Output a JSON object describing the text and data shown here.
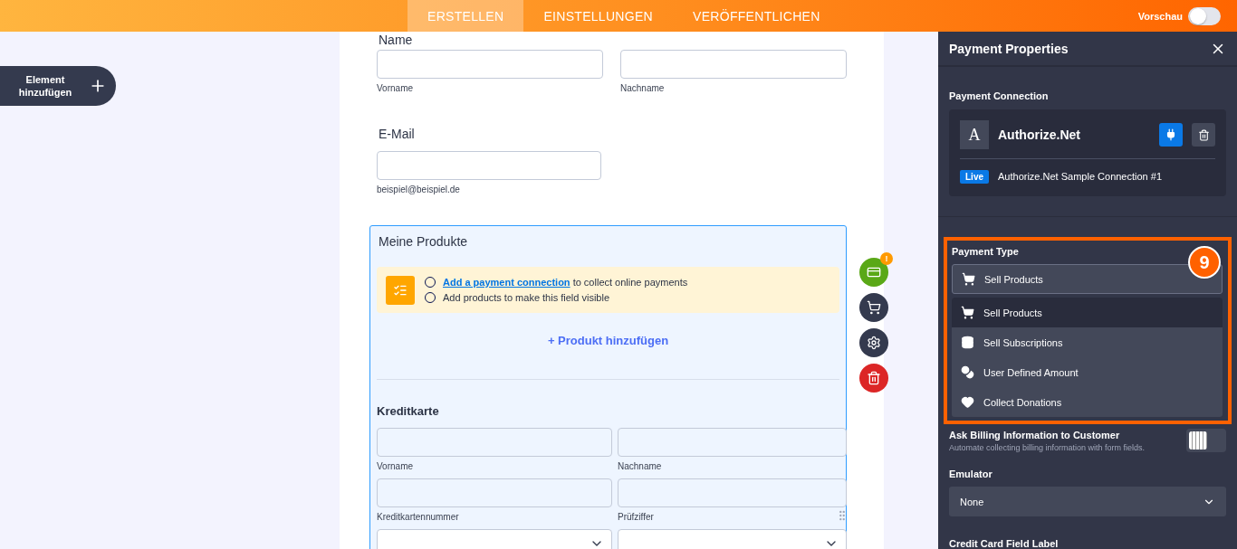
{
  "top_bar": {
    "tabs": [
      {
        "label": "ERSTELLEN",
        "selected": true
      },
      {
        "label": "EINSTELLUNGEN",
        "selected": false
      },
      {
        "label": "VERÖFFENTLICHEN",
        "selected": false
      }
    ],
    "preview": {
      "label": "Vorschau",
      "on": false
    }
  },
  "add_element_button": {
    "label": "Element hinzufügen"
  },
  "form": {
    "name_field": {
      "label": "Name",
      "sublabels": [
        "Vorname",
        "Nachname"
      ]
    },
    "email_field": {
      "label": "E-Mail",
      "sublabel": "beispiel@beispiel.de"
    },
    "product_field": {
      "title": "Meine Produkte",
      "notice": [
        {
          "done": false,
          "link": "Add a payment connection",
          "text": "to collect online payments"
        },
        {
          "done": false,
          "text": "Add products to make this field visible"
        }
      ],
      "add_product": "+ Produkt hinzufügen",
      "credit_card": {
        "title": "Kreditkarte",
        "fields": [
          {
            "kind": "text",
            "label": "Vorname"
          },
          {
            "kind": "text",
            "label": "Nachname"
          },
          {
            "kind": "text",
            "label": "Kreditkartennummer"
          },
          {
            "kind": "text",
            "label": "Prüfziffer"
          },
          {
            "kind": "select"
          },
          {
            "kind": "select"
          }
        ]
      }
    },
    "actions": [
      {
        "kind": "payment",
        "badge": "!"
      },
      {
        "kind": "products"
      },
      {
        "kind": "settings"
      },
      {
        "kind": "delete"
      }
    ]
  },
  "properties_panel": {
    "title": "Payment Properties",
    "connection": {
      "heading": "Payment Connection",
      "logo_letter": "A",
      "name": "Authorize.Net",
      "badge": "Live",
      "connection_name": "Authorize.Net Sample Connection #1"
    },
    "payment_type": {
      "heading": "Payment Type",
      "annotation": "9",
      "value": "Sell Products",
      "options": [
        {
          "kind": "cart",
          "label": "Sell Products",
          "selected": true
        },
        {
          "kind": "subscription",
          "label": "Sell Subscriptions",
          "selected": false
        },
        {
          "kind": "coins",
          "label": "User Defined Amount",
          "selected": false
        },
        {
          "kind": "heart",
          "label": "Collect Donations",
          "selected": false
        }
      ]
    },
    "billing": {
      "title": "Ask Billing Information to Customer",
      "description": "Automate collecting billing information with form fields.",
      "on": false
    },
    "emulator": {
      "heading": "Emulator",
      "value": "None"
    },
    "card_label": {
      "heading": "Credit Card Field Label"
    }
  }
}
